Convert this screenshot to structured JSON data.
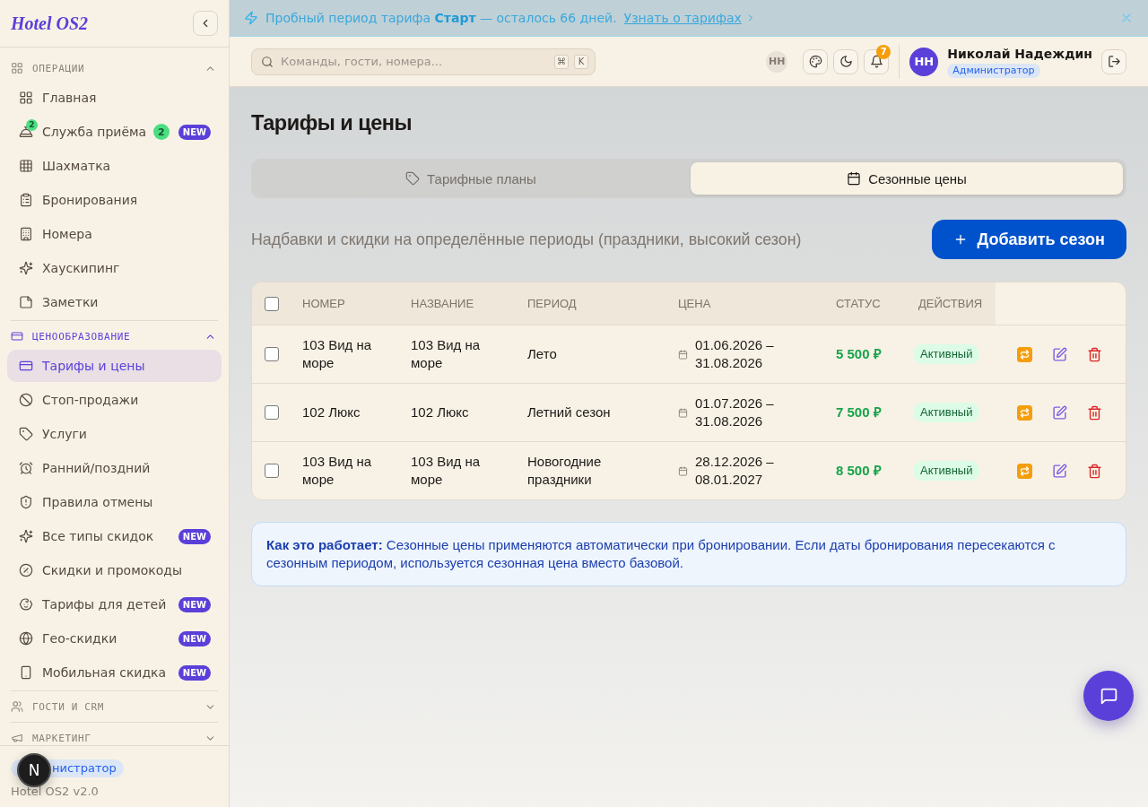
{
  "sidebar": {
    "logo": "Hotel OS2",
    "sections": [
      {
        "title": "ОПЕРАЦИИ",
        "active": false,
        "expanded": true,
        "items": [
          {
            "label": "Главная",
            "selected": false
          },
          {
            "label": "Служба приёма",
            "selected": false,
            "icon_count": "2",
            "count": "2",
            "badge": "NEW"
          },
          {
            "label": "Шахматка",
            "selected": false
          },
          {
            "label": "Бронирования",
            "selected": false
          },
          {
            "label": "Номера",
            "selected": false
          },
          {
            "label": "Хаускипинг",
            "selected": false
          },
          {
            "label": "Заметки",
            "selected": false
          }
        ]
      },
      {
        "title": "ЦЕНООБРАЗОВАНИЕ",
        "active": true,
        "expanded": true,
        "items": [
          {
            "label": "Тарифы и цены",
            "selected": true
          },
          {
            "label": "Стоп-продажи",
            "selected": false
          },
          {
            "label": "Услуги",
            "selected": false
          },
          {
            "label": "Ранний/поздний",
            "selected": false
          },
          {
            "label": "Правила отмены",
            "selected": false
          },
          {
            "label": "Все типы скидок",
            "selected": false,
            "badge": "NEW"
          },
          {
            "label": "Скидки и промокоды",
            "selected": false
          },
          {
            "label": "Тарифы для детей",
            "selected": false,
            "badge": "NEW"
          },
          {
            "label": "Гео-скидки",
            "selected": false,
            "badge": "NEW"
          },
          {
            "label": "Мобильная скидка",
            "selected": false,
            "badge": "NEW"
          }
        ]
      },
      {
        "title": "ГОСТИ И CRM",
        "active": false,
        "expanded": false
      },
      {
        "title": "МАРКЕТИНГ",
        "active": false,
        "expanded": false
      }
    ],
    "footer": {
      "role_badge": "нистратор",
      "version": "Hotel OS2 v2.0"
    }
  },
  "dev_indicator": {
    "label": "N"
  },
  "banner": {
    "text": "Пробный период тарифа **Старт** — осталось 66 дней.",
    "link": "Узнать о тарифах"
  },
  "header": {
    "search": {
      "placeholder": "Команды, гости, номера...",
      "shortcut": [
        "⌘",
        "K"
      ]
    },
    "presence": "НН",
    "notifications": "7",
    "user": {
      "initials": "НН",
      "name": "Николай Надеждин",
      "role": "Администратор"
    }
  },
  "page": {
    "title": "Тарифы и цены",
    "tabs": [
      {
        "label": "Тарифные планы",
        "selected": false
      },
      {
        "label": "Сезонные цены",
        "selected": true
      }
    ],
    "description": "Надбавки и скидки на определённые периоды (праздники, высокий сезон)",
    "add_button": "Добавить сезон",
    "table": {
      "select_all_checked": false,
      "columns": [
        "НОМЕР",
        "НАЗВАНИЕ",
        "ПЕРИОД",
        "ЦЕНА",
        "СТАТУС",
        "ДЕЙСТВИЯ"
      ],
      "rows": [
        {
          "checked": false,
          "room": "103 Вид на море",
          "name": "103 Вид на море",
          "period": "Лето",
          "dates": "01.06.2026 – 31.08.2026",
          "price": "5 500 ₽",
          "status": "Активный"
        },
        {
          "checked": false,
          "room": "102 Люкс",
          "name": "102 Люкс",
          "period": "Летний сезон",
          "dates": "01.07.2026 – 31.08.2026",
          "price": "7 500 ₽",
          "status": "Активный"
        },
        {
          "checked": false,
          "room": "103 Вид на море",
          "name": "103 Вид на море",
          "period": "Новогодние праздники",
          "dates": "28.12.2026 – 08.01.2027",
          "price": "8 500 ₽",
          "status": "Активный"
        }
      ]
    },
    "info": "**Как это работает:** Сезонные цены применяются автоматически при бронировании. Если даты бронирования пересекаются с сезонным периодом, используется сезонная цена вместо базовой."
  }
}
